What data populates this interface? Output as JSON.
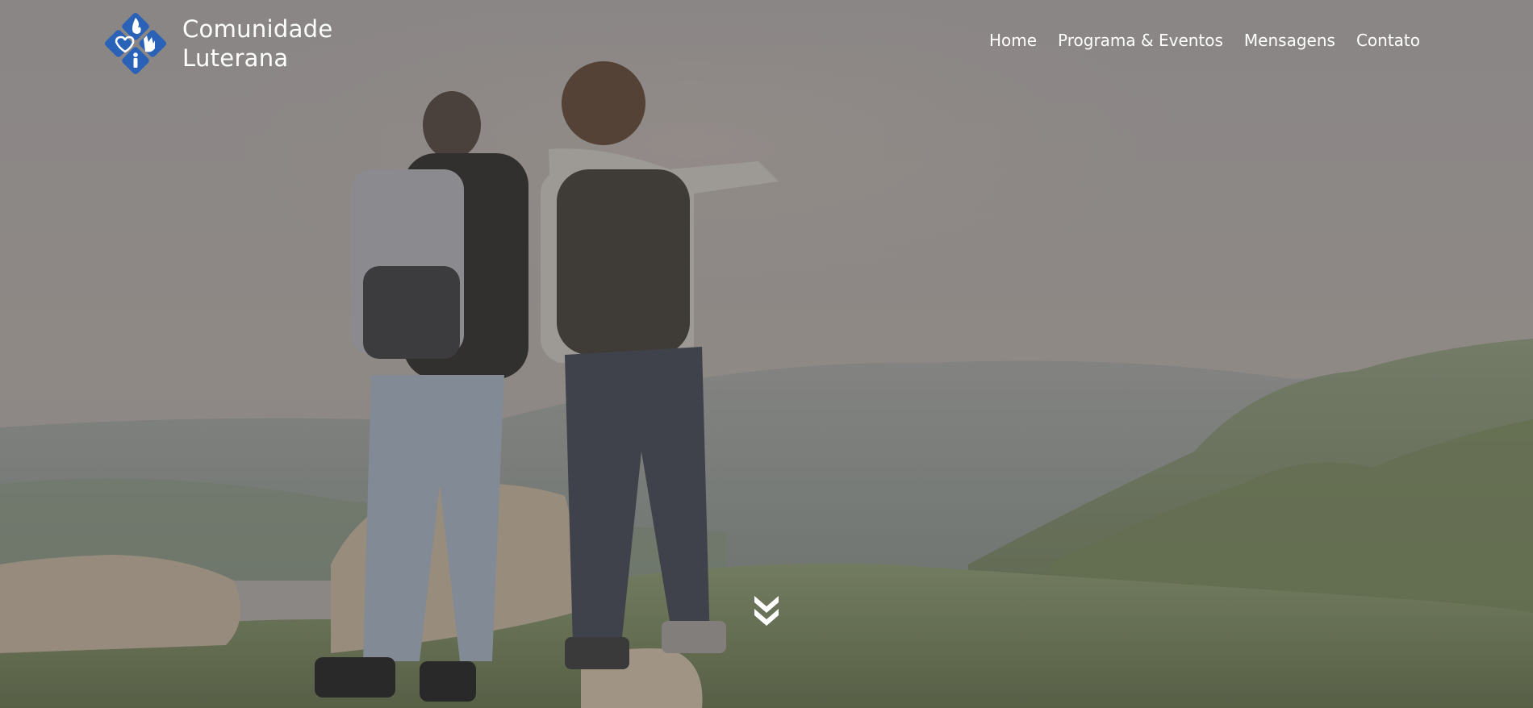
{
  "header": {
    "brand": {
      "line1": "Comunidade",
      "line2": "Luterana",
      "logo_icon": "church-logo-icon"
    },
    "nav": [
      {
        "label": "Home"
      },
      {
        "label": "Programa & Eventos"
      },
      {
        "label": "Mensagens"
      },
      {
        "label": "Contato"
      }
    ]
  },
  "hero": {
    "background": "hikers-overlooking-valley-photo",
    "scroll_icon": "double-chevron-down-icon"
  },
  "colors": {
    "nav_text": "#ffffff",
    "logo_blue": "#2a62b8"
  }
}
